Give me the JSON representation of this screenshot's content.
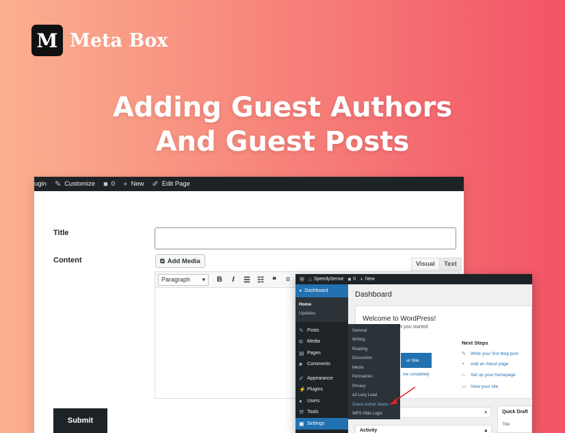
{
  "brand": {
    "logo_letter": "M",
    "name": "Meta Box"
  },
  "headline": {
    "line1": "Adding Guest Authors",
    "line2": "And Guest Posts"
  },
  "editor": {
    "adminbar": [
      {
        "label": "ugin",
        "icon": ""
      },
      {
        "label": "Customize",
        "icon": "brush-icon"
      },
      {
        "label": "0",
        "icon": "comment-icon"
      },
      {
        "label": "New",
        "icon": "plus-icon"
      },
      {
        "label": "Edit Page",
        "icon": "pencil-icon"
      }
    ],
    "title_label": "Title",
    "content_label": "Content",
    "add_media": "Add Media",
    "tab_visual": "Visual",
    "tab_text": "Text",
    "format_select": "Paragraph",
    "submit": "Submit"
  },
  "dashboard": {
    "adminbar": {
      "site": "SpeedySense",
      "comments": "0",
      "new": "New"
    },
    "menu": {
      "dashboard": "Dashboard",
      "home": "Home",
      "updates": "Updates",
      "items": [
        "Posts",
        "Media",
        "Pages",
        "Comments",
        "Appearance",
        "Plugins",
        "Users",
        "Tools",
        "Settings"
      ]
    },
    "settings_flyout": [
      "General",
      "Writing",
      "Reading",
      "Discussion",
      "Media",
      "Permalinks",
      "Privacy",
      "a3 Lazy Load",
      "Guest Author Name",
      "WPS Hide Login"
    ],
    "title": "Dashboard",
    "welcome_title": "Welcome to WordPress!",
    "welcome_sub": "d some links to get you started:",
    "customize_btn": "ur Site",
    "complete_link": "me completely",
    "next_steps_title": "Next Steps",
    "next_steps": [
      "Write your first blog post",
      "Add an About page",
      "Set up your homepage",
      "View your site"
    ],
    "quick_draft": "Quick Draft",
    "quick_draft_title": "Title",
    "activity": "Activity",
    "accent": "#2271b1"
  }
}
